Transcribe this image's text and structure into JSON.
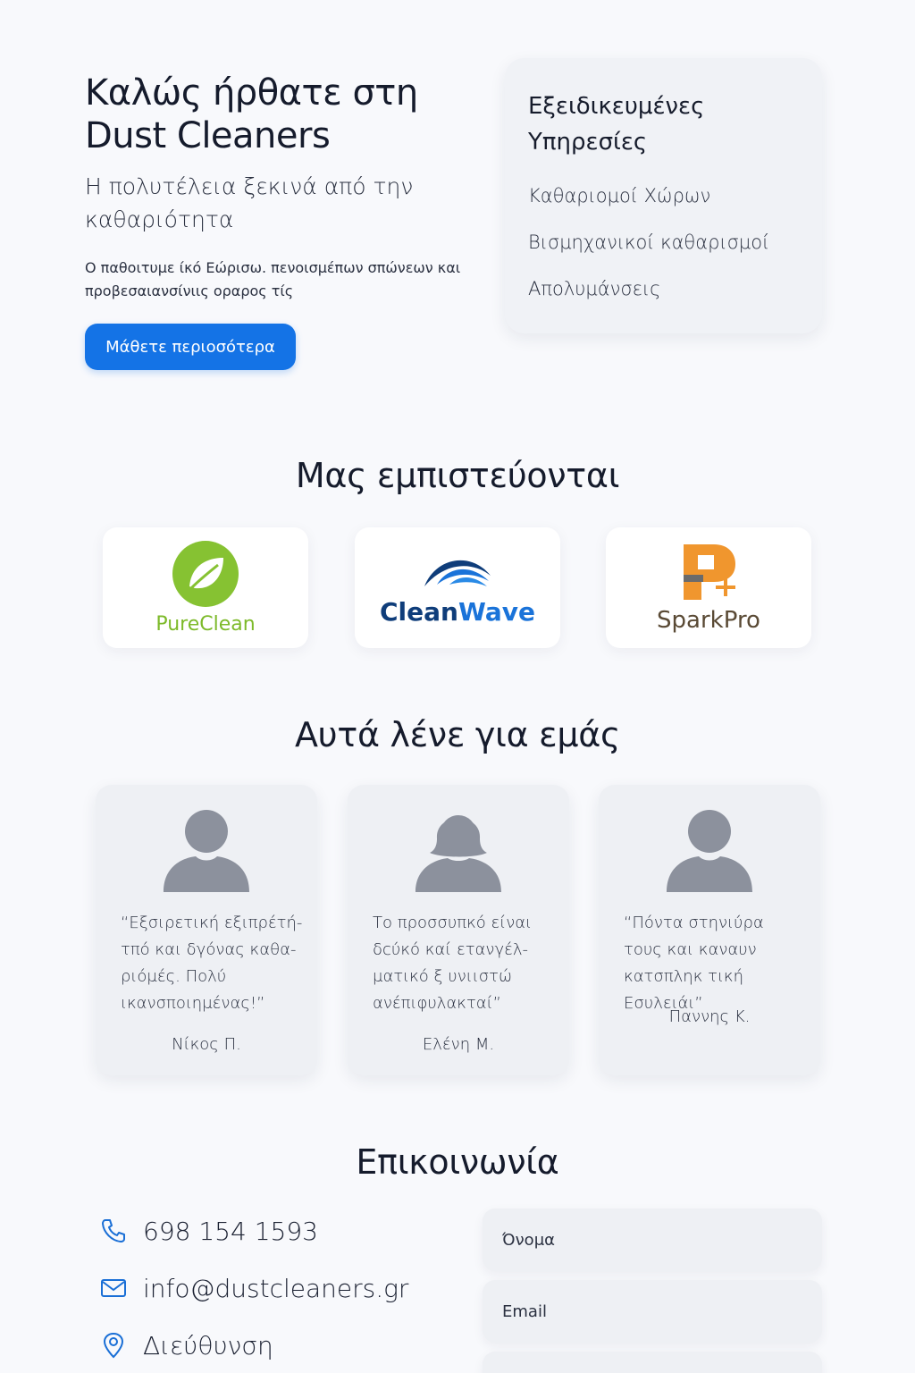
{
  "hero": {
    "title": "Καλώς ήρθατε στη Dust Cleaners",
    "subtitle": "Η πολυτέλεια ξεκινά από την καθαριότητα",
    "body": "Ο παθοιτυμε ίκό Εώρισω. πενοισμέπων σπώνεων και προβεσαιανσίνιις οραρος τίς",
    "cta_label": "Μάθετε περιοσότερα",
    "cta_color": "#1473e6"
  },
  "services": {
    "title": "Εξειδικευμένες Υπηρεσίες",
    "items": [
      "Καθαριομοί Χώρων",
      "Βισμηχανικοί καθαρισμοί",
      "Απολυμάνσεις"
    ]
  },
  "trust": {
    "heading": "Μας εμπιστεύονται",
    "logos": [
      {
        "name": "PureClean",
        "icon": "leaf-icon",
        "color": "#7dba2a"
      },
      {
        "name_part1": "Clean",
        "name_part2": "Wave",
        "icon": "wave-icon",
        "color1": "#0f3d7a",
        "color2": "#1a73d9"
      },
      {
        "name": "SparkPro",
        "icon": "spark-icon",
        "color": "#f0962e",
        "text_color": "#5a4a35"
      }
    ]
  },
  "testimonials": {
    "heading": "Αυτά λένε για εμάς",
    "items": [
      {
        "quote": "“Εξσιρετική εξιπρέτή-τπό και δγόνας καθα-ριόμές. Πολύ ικανσποιημένας!”",
        "author": "Νίκος Π.",
        "avatar": "male-avatar-icon"
      },
      {
        "quote": "Το προσσυπκό είναι δcύκό καί ετανγέλ-ματικό ξ υνιιστώ ανέπιφυλακταί”",
        "author": "Ελένη Μ.",
        "avatar": "female-avatar-icon"
      },
      {
        "quote": "“Πόντα στηνιύρα τους και καναυν κατσπληκ τική Εσυλειάι”",
        "author": "Παννης Κ.",
        "avatar": "male-avatar-icon"
      }
    ]
  },
  "contact": {
    "heading": "Επικοινωνία",
    "phone": "698 154 1593",
    "email": "info@dustcleaners.gr",
    "address": "Διεύθυνση",
    "form": {
      "name_placeholder": "Όνομα",
      "email_placeholder": "Email"
    }
  }
}
